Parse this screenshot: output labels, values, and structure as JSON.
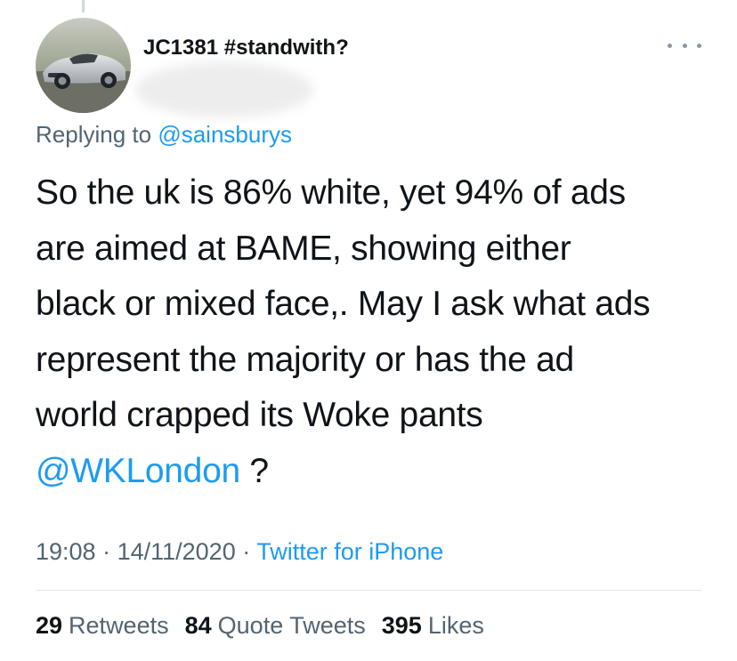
{
  "user": {
    "display_name": "JC1381 #standwith?"
  },
  "reply": {
    "prefix": "Replying to",
    "mention": "@sainsburys"
  },
  "tweet": {
    "lines": [
      "So the uk is 86% white, yet 94% of ads",
      "are aimed at BAME, showing either",
      "black or mixed face,. May I ask what ads",
      "represent the majority or has the ad",
      "world crapped its Woke pants"
    ],
    "mention": "@WKLondon",
    "trailing": " ?"
  },
  "meta": {
    "time": "19:08",
    "sep1": " · ",
    "date": "14/11/2020",
    "sep2": " · ",
    "source": "Twitter for iPhone"
  },
  "stats": {
    "retweets": {
      "count": "29",
      "label": "Retweets"
    },
    "quotes": {
      "count": "84",
      "label": "Quote Tweets"
    },
    "likes": {
      "count": "395",
      "label": "Likes"
    }
  },
  "icons": {
    "more": "more-horizontal-icon"
  },
  "colors": {
    "link": "#1d9bf0",
    "secondary": "#536471",
    "primary": "#0f1419"
  }
}
